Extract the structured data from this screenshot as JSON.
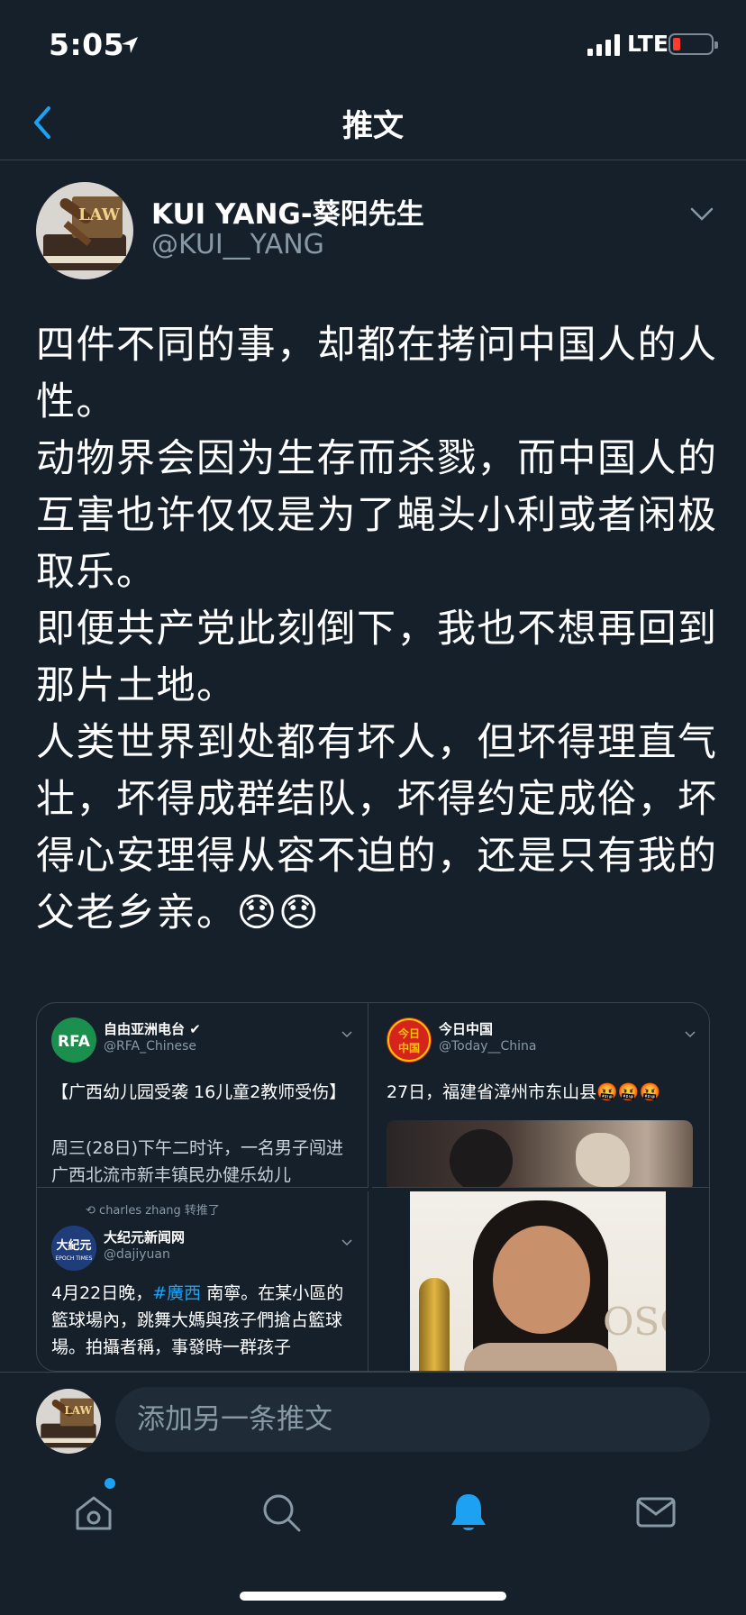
{
  "status_bar": {
    "time": "5:05",
    "network": "LTE"
  },
  "header": {
    "title": "推文"
  },
  "tweet": {
    "author_name": "KUI YANG-葵阳先生",
    "author_handle": "@KUI__YANG",
    "avatar_text": "LAW",
    "body": "四件不同的事，却都在拷问中国人的人性。\n动物界会因为生存而杀戮，而中国人的互害也许仅仅是为了蝇头小利或者闲极取乐。\n即便共产党此刻倒下，我也不想再回到那片土地。\n人类世界到处都有坏人，但坏得理直气壮，坏得成群结队，坏得约定成俗，坏得心安理得从容不迫的，还是只有我的父老乡亲。😞😞"
  },
  "quoted": [
    {
      "avatar_label": "RFA",
      "name": "自由亚洲电台",
      "handle": "@RFA_Chinese",
      "text": "【广西幼儿园受袭 16儿童2教师受伤】",
      "subtext": "周三(28日)下午二时许，一名男子闯进广西北流市新丰镇民办健乐幼儿"
    },
    {
      "avatar_label": "今日中国",
      "name": "今日中国",
      "handle": "@Today__China",
      "text": "27日，福建省漳州市东山县🤬🤬🤬"
    },
    {
      "retweet_note": "charles zhang 转推了",
      "avatar_label": "大紀元",
      "name": "大纪元新闻网",
      "handle": "@dajiyuan",
      "text_prefix": "4月22日晚，",
      "hashtag": "#廣西",
      "text_suffix": " 南寧。在某小區的籃球場內，跳舞大媽與孩子們搶占籃球場。拍攝者稱，事發時一群孩子"
    },
    {
      "image_text": "OSCA"
    }
  ],
  "reply": {
    "placeholder": "添加另一条推文"
  },
  "tabs": [
    "home",
    "search",
    "notifications",
    "messages"
  ],
  "colors": {
    "background": "#15202b",
    "accent": "#1da1f2",
    "muted": "#8899a6",
    "divider": "#38444d"
  }
}
